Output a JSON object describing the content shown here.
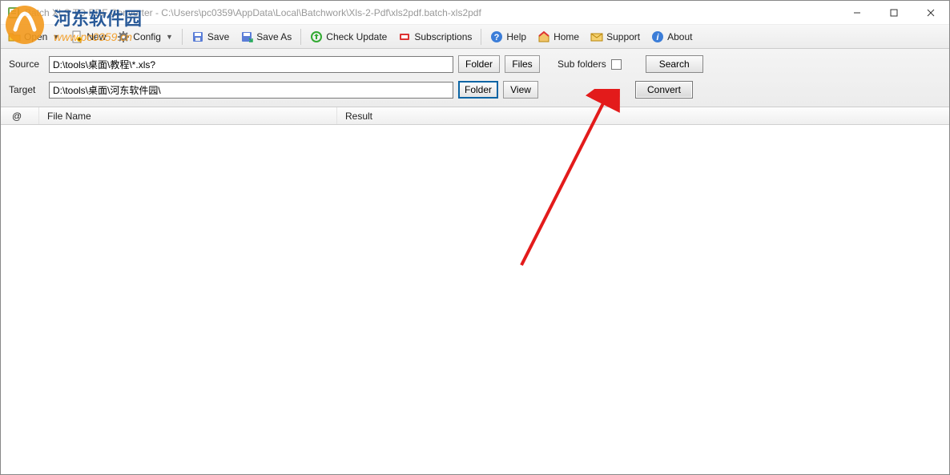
{
  "window": {
    "title": "Batch XLS TO PDF Converter - C:\\Users\\pc0359\\AppData\\Local\\Batchwork\\Xls-2-Pdf\\xls2pdf.batch-xls2pdf"
  },
  "toolbar": {
    "open": "Open",
    "new": "New",
    "config": "Config",
    "save": "Save",
    "save_as": "Save As",
    "check_update": "Check Update",
    "subscriptions": "Subscriptions",
    "help": "Help",
    "home": "Home",
    "support": "Support",
    "about": "About"
  },
  "path": {
    "source_label": "Source",
    "source_value": "D:\\tools\\桌面\\教程\\*.xls?",
    "target_label": "Target",
    "target_value": "D:\\tools\\桌面\\河东软件园\\",
    "folder_btn": "Folder",
    "files_btn": "Files",
    "view_btn": "View",
    "subfolders_label": "Sub folders",
    "search_btn": "Search",
    "convert_btn": "Convert"
  },
  "list": {
    "col_at": "@",
    "col_filename": "File Name",
    "col_result": "Result"
  },
  "watermark": {
    "text_top": "河东软件园",
    "text_bottom": "www.pc0359.cn"
  }
}
